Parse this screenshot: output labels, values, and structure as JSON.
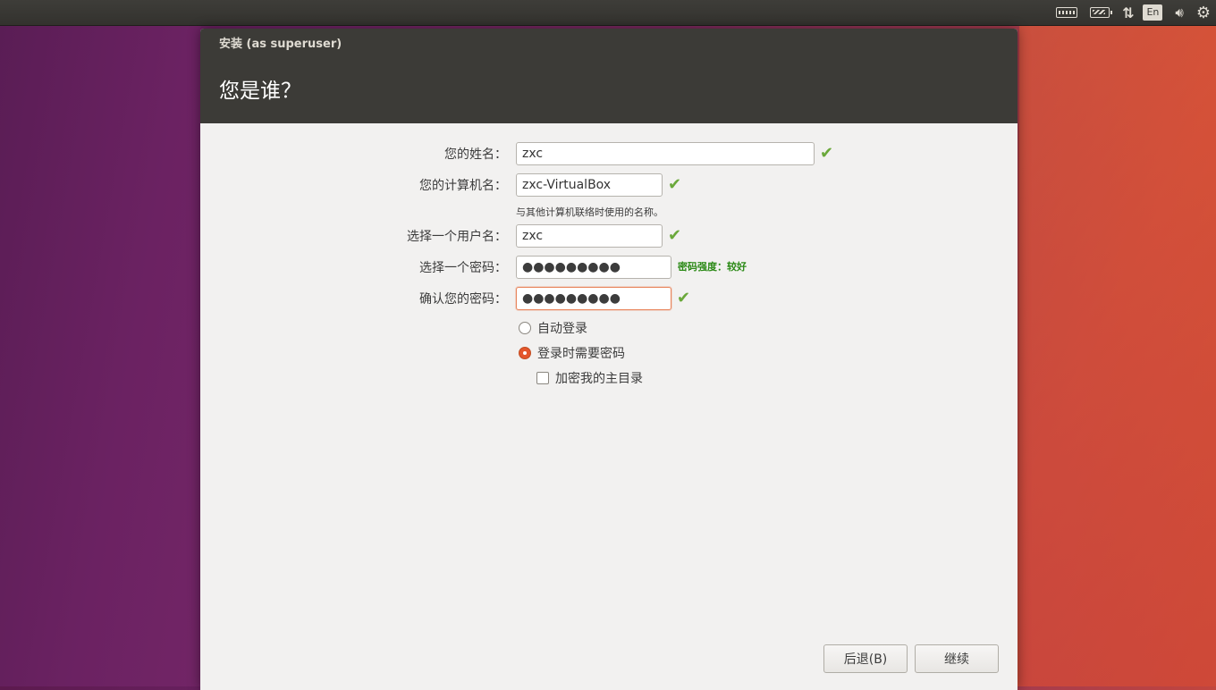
{
  "panel": {
    "language": "En",
    "icons": [
      "keyboard-icon",
      "battery-icon",
      "network-icon",
      "volume-icon",
      "gear-icon"
    ]
  },
  "window": {
    "title": "安装 (as superuser)",
    "page_title": "您是谁？"
  },
  "form": {
    "name": {
      "label": "您的姓名：",
      "value": "zxc"
    },
    "computer": {
      "label": "您的计算机名：",
      "value": "zxc-VirtualBox",
      "hint": "与其他计算机联络时使用的名称。"
    },
    "username": {
      "label": "选择一个用户名：",
      "value": "zxc"
    },
    "password": {
      "label": "选择一个密码：",
      "value": "●●●●●●●●●",
      "strength": "密码强度：较好"
    },
    "confirm": {
      "label": "确认您的密码：",
      "value": "●●●●●●●●●"
    },
    "auto_login": {
      "label": "自动登录",
      "checked": false
    },
    "require_password": {
      "label": "登录时需要密码",
      "checked": true
    },
    "encrypt_home": {
      "label": "加密我的主目录",
      "checked": false
    }
  },
  "buttons": {
    "back": "后退(B)",
    "continue": "继续"
  },
  "colors": {
    "accent": "#e4562c",
    "valid": "#6aa83a",
    "strength_text": "#2c8a17",
    "header_bg": "#3c3b37"
  }
}
